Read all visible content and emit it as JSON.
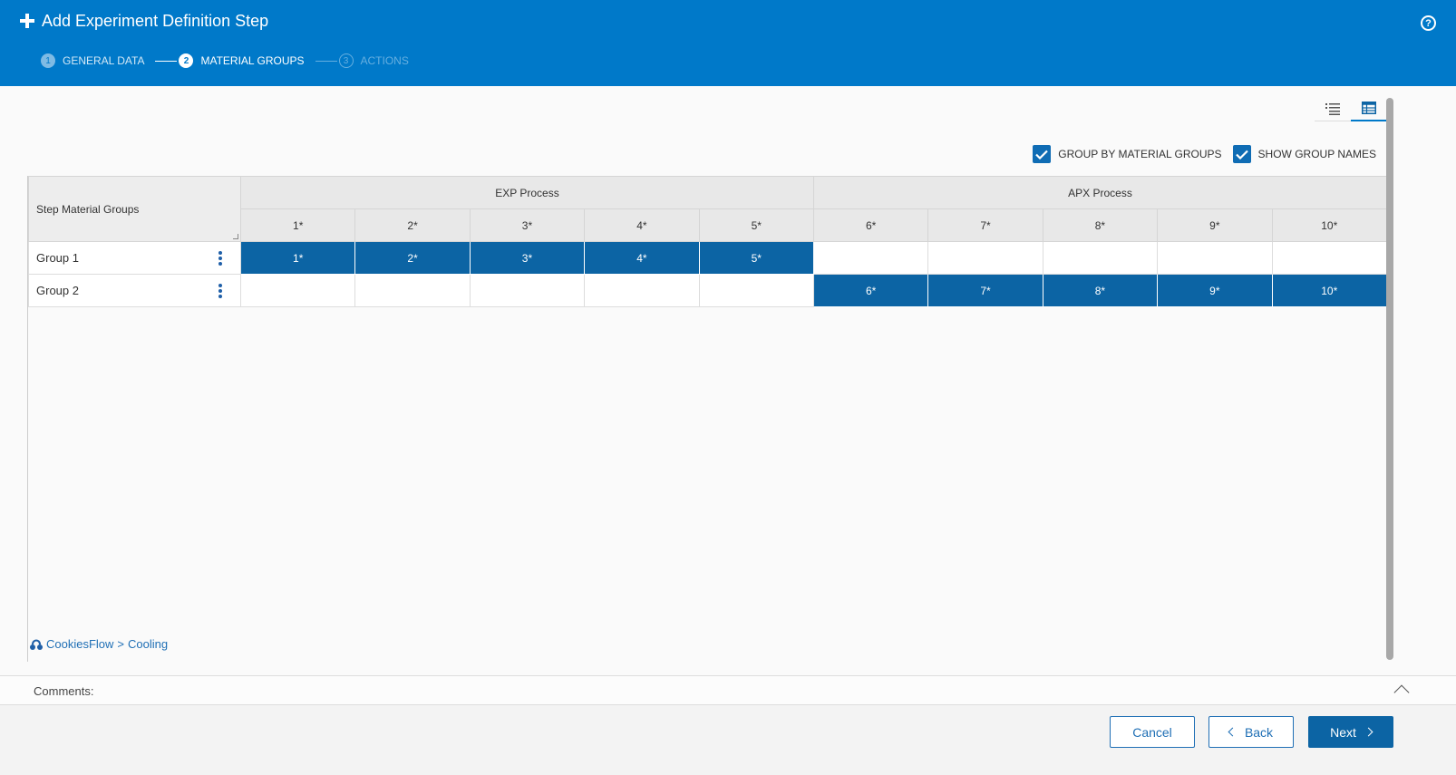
{
  "header": {
    "title": "Add Experiment Definition Step",
    "steps": [
      {
        "num": "1",
        "label": "GENERAL DATA"
      },
      {
        "num": "2",
        "label": "MATERIAL GROUPS"
      },
      {
        "num": "3",
        "label": "ACTIONS"
      }
    ],
    "help": "?"
  },
  "options": {
    "group_by": "GROUP BY MATERIAL GROUPS",
    "show_names": "SHOW GROUP NAMES"
  },
  "grid": {
    "corner_header": "Step Material Groups",
    "process_groups": [
      "EXP Process",
      "APX Process"
    ],
    "columns": [
      "1*",
      "2*",
      "3*",
      "4*",
      "5*",
      "6*",
      "7*",
      "8*",
      "9*",
      "10*"
    ],
    "rows": [
      {
        "name": "Group 1",
        "cells": [
          "1*",
          "2*",
          "3*",
          "4*",
          "5*",
          "",
          "",
          "",
          "",
          ""
        ]
      },
      {
        "name": "Group 2",
        "cells": [
          "",
          "",
          "",
          "",
          "",
          "6*",
          "7*",
          "8*",
          "9*",
          "10*"
        ]
      }
    ]
  },
  "breadcrumb": {
    "flow": "CookiesFlow",
    "separator": ">",
    "step": "Cooling"
  },
  "comments": {
    "label": "Comments:"
  },
  "footer": {
    "cancel": "Cancel",
    "back": "Back",
    "next": "Next"
  },
  "colors": {
    "header": "#0079c9",
    "selected_cell": "#0c64a4"
  }
}
